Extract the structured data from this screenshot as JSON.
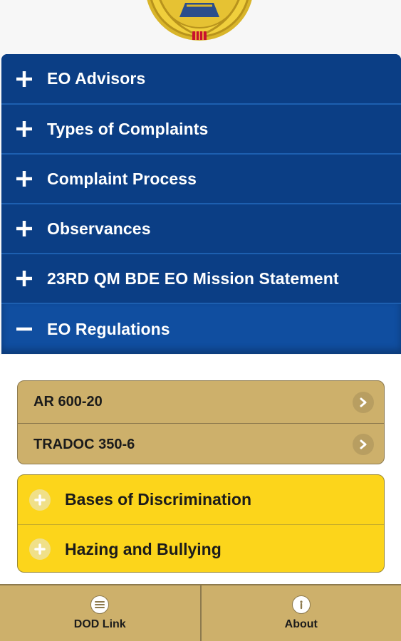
{
  "accordion": {
    "items": [
      {
        "label": "EO Advisors",
        "icon": "plus-icon"
      },
      {
        "label": "Types of Complaints",
        "icon": "plus-icon"
      },
      {
        "label": "Complaint Process",
        "icon": "plus-icon"
      },
      {
        "label": "Observances",
        "icon": "plus-icon"
      },
      {
        "label": "23RD QM BDE EO Mission Statement",
        "icon": "plus-icon"
      },
      {
        "label": "EO Regulations",
        "icon": "minus-icon",
        "expanded": true
      }
    ]
  },
  "regulations": {
    "links": [
      {
        "label": "AR 600-20",
        "icon": "chevron-right-icon"
      },
      {
        "label": "TRADOC 350-6",
        "icon": "chevron-right-icon"
      }
    ],
    "sub_sections": [
      {
        "label": "Bases of Discrimination",
        "icon": "plus-circle-icon"
      },
      {
        "label": "Hazing and Bullying",
        "icon": "plus-circle-icon"
      }
    ]
  },
  "bottom_nav": {
    "items": [
      {
        "label": "DOD Link",
        "icon": "menu-icon"
      },
      {
        "label": "About",
        "icon": "info-icon"
      }
    ]
  },
  "colors": {
    "accordion_blue": "#0b3e85",
    "active_blue": "#104ea0",
    "gold": "#cdb06b",
    "yellow": "#fcd51b"
  }
}
